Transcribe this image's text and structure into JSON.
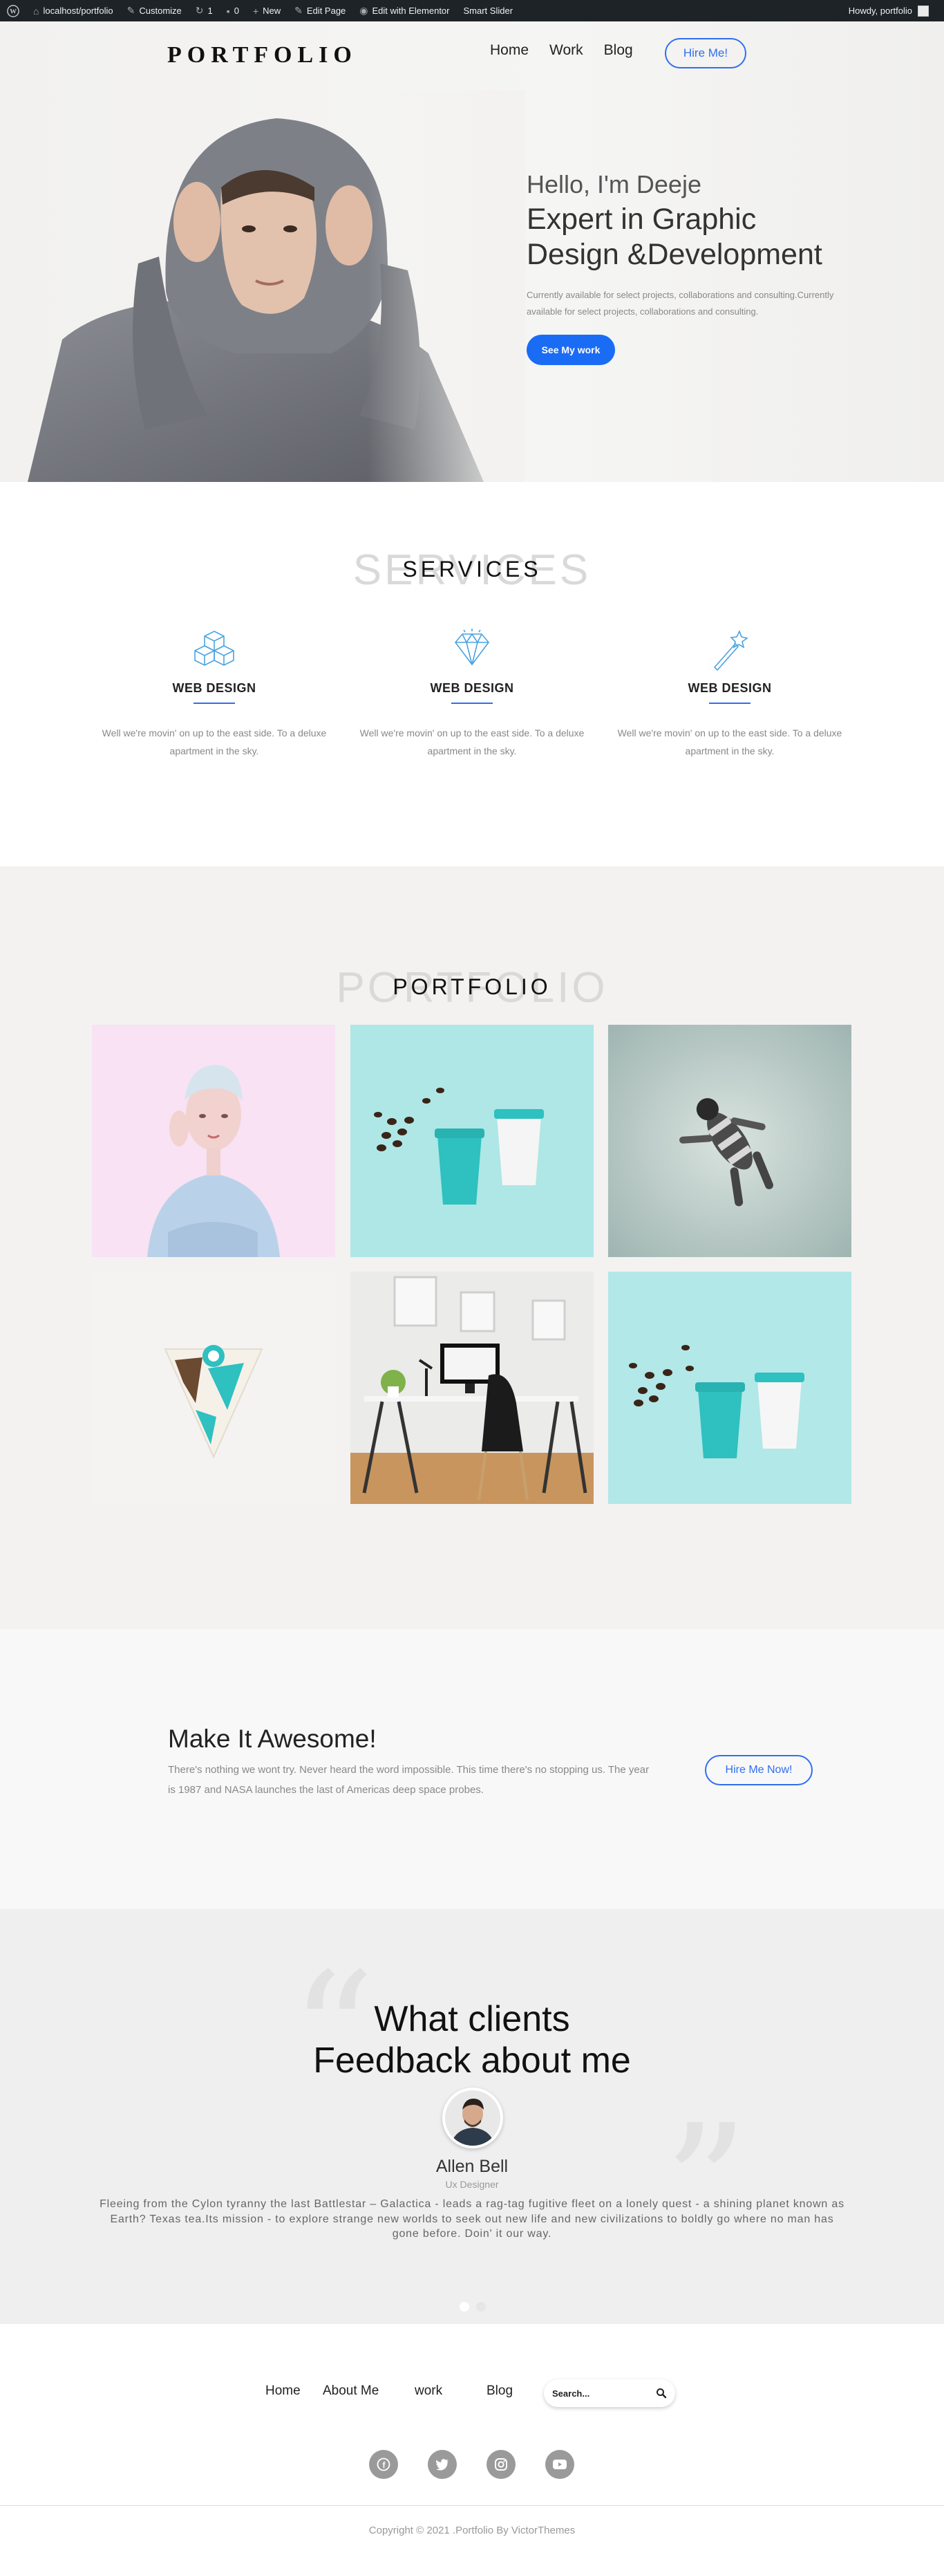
{
  "admin_bar": {
    "site": "localhost/portfolio",
    "customize": "Customize",
    "updates": "1",
    "comments": "0",
    "new": "New",
    "edit_page": "Edit Page",
    "elementor": "Edit with Elementor",
    "slider": "Smart Slider",
    "howdy": "Howdy, portfolio"
  },
  "header": {
    "logo": "PORTFOLIO",
    "nav": [
      "Home",
      "Work",
      "Blog"
    ],
    "hire": "Hire Me!"
  },
  "hero": {
    "hello": "Hello, I'm Deeje",
    "title_1": "Expert in Graphic",
    "title_2": "Design &Development",
    "subtitle": "Currently available for select projects, collaborations and consulting.Currently available for select projects, collaborations and consulting.",
    "button": "See My work"
  },
  "services": {
    "ghost": "SERVICES",
    "title": "SERVICES",
    "items": [
      {
        "icon": "cubes-icon",
        "title": "WEB DESIGN",
        "text": "Well we're movin' on up to the east side. To a deluxe apartment in the sky."
      },
      {
        "icon": "diamond-icon",
        "title": "WEB DESIGN",
        "text": "Well we're movin' on up to the east side. To a deluxe apartment in the sky."
      },
      {
        "icon": "magic-wand-icon",
        "title": "WEB DESIGN",
        "text": "Well we're movin' on up to the east side. To a deluxe apartment in the sky."
      }
    ]
  },
  "portfolio": {
    "ghost": "PORTFOLIO",
    "title": "PORTFOLIO"
  },
  "cta": {
    "title": "Make It Awesome!",
    "text": "There's nothing we wont try. Never heard the word impossible. This time there's no stopping us. The year is 1987 and NASA launches the last of Americas deep space probes.",
    "button": "Hire Me Now!"
  },
  "testimonial": {
    "title_1": "What clients",
    "title_2": "Feedback about me",
    "name": "Allen Bell",
    "role": "Ux Designer",
    "text": "Fleeing from the Cylon tyranny the last Battlestar – Galactica - leads a rag-tag fugitive fleet on a lonely quest - a shining planet known as Earth? Texas tea.Its mission - to explore strange new worlds to seek out new life and new civilizations to boldly go where no man has gone before. Doin' it our way."
  },
  "footer": {
    "nav": [
      "Home",
      "About Me",
      "work",
      "Blog"
    ],
    "search_placeholder": "Search...",
    "social": [
      "facebook-icon",
      "twitter-icon",
      "instagram-icon",
      "youtube-icon"
    ],
    "copyright": "Copyright © 2021 .Portfolio By VictorThemes"
  },
  "colors": {
    "accent": "#2f6ff0",
    "admin_bar": "#1d2327",
    "primary_button": "#1a6cf5"
  }
}
